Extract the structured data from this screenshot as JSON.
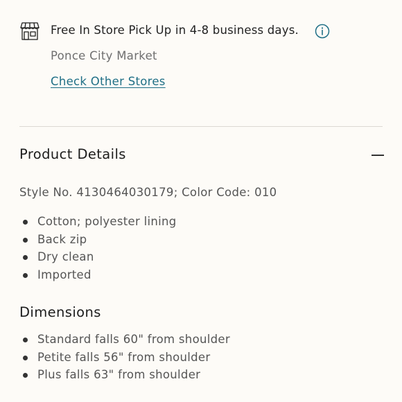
{
  "pickup": {
    "icon": "store-icon",
    "message": "Free In Store Pick Up in 4-8 business days.",
    "info_icon": "info-icon",
    "store_name": "Ponce City Market",
    "check_other_label": "Check Other Stores",
    "link_color": "#1f6f86"
  },
  "product_details": {
    "title": "Product Details",
    "toggle_icon": "minus-icon",
    "style_line": "Style No. 4130464030179; Color Code: 010",
    "features": [
      "Cotton; polyester lining",
      "Back zip",
      "Dry clean",
      "Imported"
    ]
  },
  "dimensions": {
    "title": "Dimensions",
    "items": [
      "Standard falls 60\" from shoulder",
      "Petite falls 56\" from shoulder",
      "Plus falls 63\" from shoulder"
    ]
  }
}
